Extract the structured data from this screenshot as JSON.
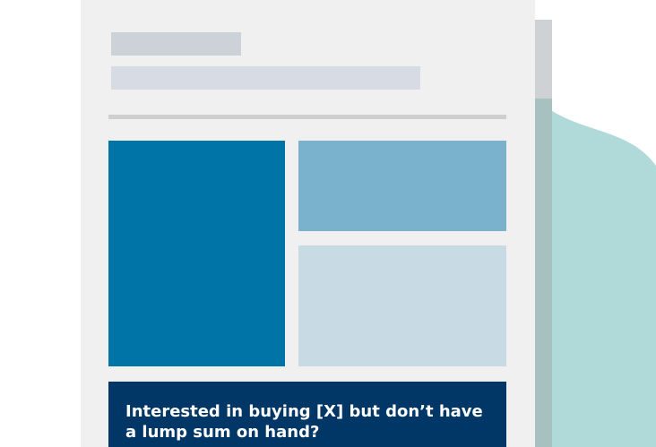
{
  "banner": {
    "text": "Interested in buying [X] but don’t have a lump sum on hand?"
  },
  "colors": {
    "card_background": "#f0f0f0",
    "placeholder_title": "#cdd2d9",
    "placeholder_subtitle": "#d6dbe4",
    "divider": "#cfcfcf",
    "block_main": "#0074a6",
    "block_top_right": "#7ab2cd",
    "block_bottom_right": "#c8dbe4",
    "banner_background": "#003767",
    "banner_text": "#ffffff",
    "decorative_blob": "#afdad9",
    "card_shadow": "#cfd2d4"
  }
}
